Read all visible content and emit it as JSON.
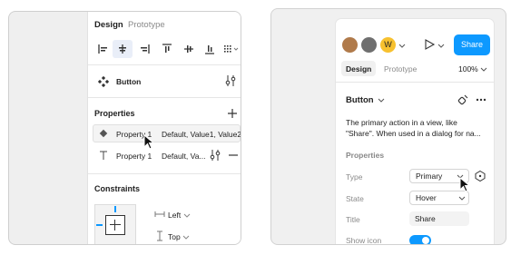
{
  "left": {
    "tabs": [
      {
        "label": "Design"
      },
      {
        "label": "Prototype"
      }
    ],
    "component": {
      "name": "Button"
    },
    "properties": {
      "title": "Properties",
      "add_icon": "plus-icon",
      "rows": [
        {
          "icon": "diamond-icon",
          "name": "Property 1",
          "value": "Default, Value1, Value2"
        },
        {
          "icon": "text-icon",
          "name": "Property 1",
          "value": "Default, Va..."
        }
      ]
    },
    "constraints": {
      "title": "Constraints",
      "horizontal": "Left",
      "vertical": "Top"
    }
  },
  "right": {
    "avatars": [
      {
        "color": "#b07a4a"
      },
      {
        "color": "#6f6f6f"
      },
      {
        "initial": "W",
        "color": "#f7c12f"
      }
    ],
    "share_label": "Share",
    "tabs": [
      {
        "label": "Design"
      },
      {
        "label": "Prototype"
      }
    ],
    "zoom": "100%",
    "component": {
      "name": "Button",
      "description_line1": "The primary action in a view, like",
      "description_line2": "\"Share\". When used in a dialog for na..."
    },
    "properties": {
      "title": "Properties",
      "type": {
        "label": "Type",
        "value": "Primary"
      },
      "state": {
        "label": "State",
        "value": "Hover"
      },
      "title_field": {
        "label": "Title",
        "value": "Share"
      },
      "show_icon": {
        "label": "Show icon",
        "checked": true
      }
    },
    "colors": {
      "accent": "#0d99ff"
    }
  }
}
